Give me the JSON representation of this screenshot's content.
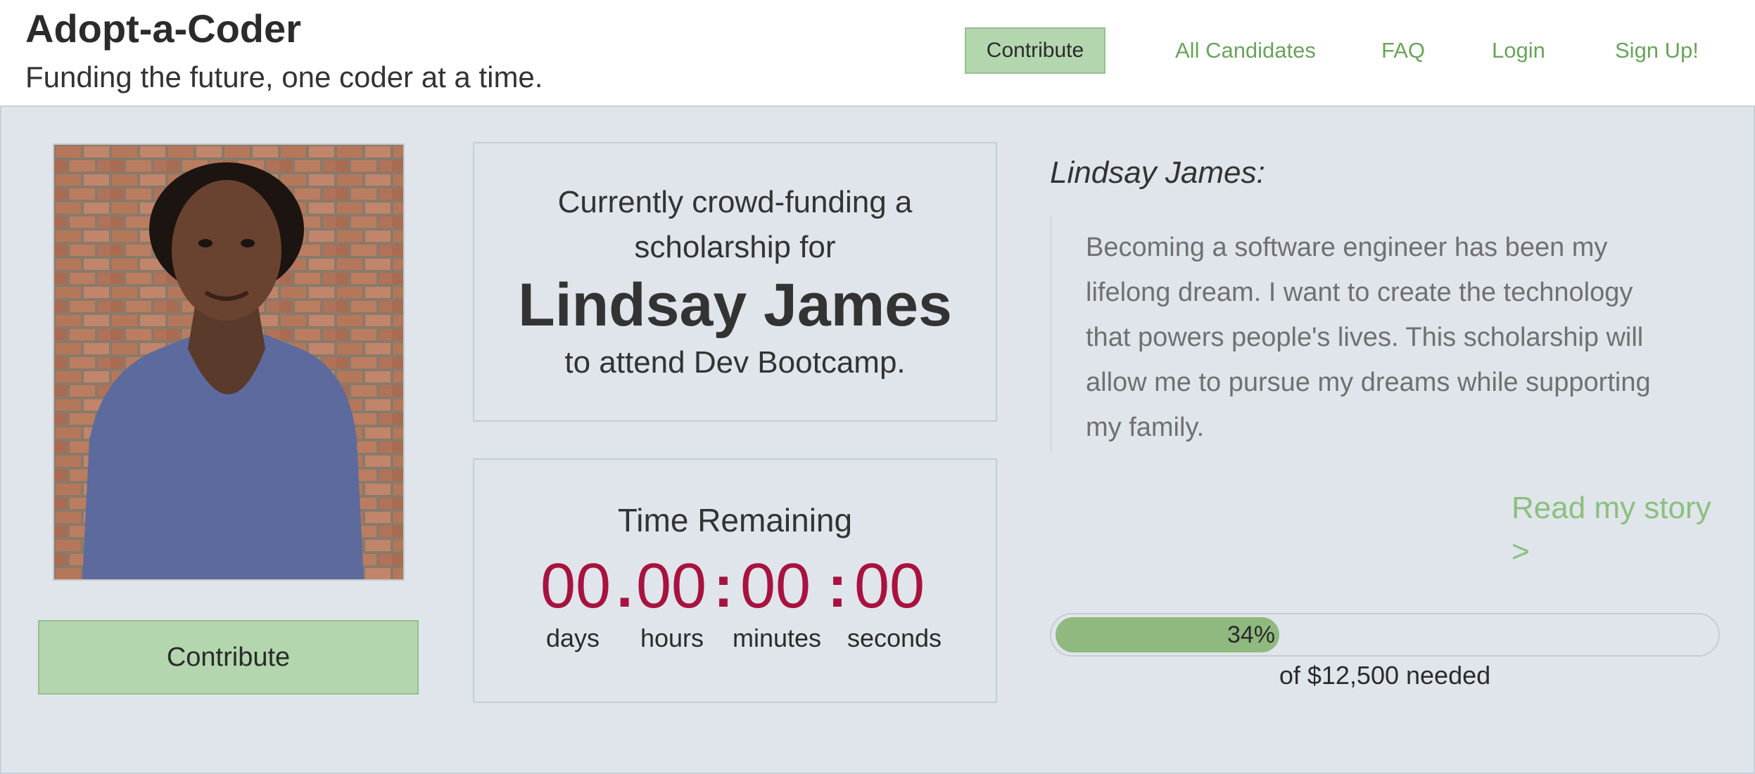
{
  "header": {
    "title": "Adopt-a-Coder",
    "tagline": "Funding the future, one coder at a time."
  },
  "nav": {
    "contribute": "Contribute",
    "all_candidates": "All Candidates",
    "faq": "FAQ",
    "login": "Login",
    "signup": "Sign Up!"
  },
  "candidate": {
    "photo_alt": "Portrait photo of Lindsay James",
    "contribute_button": "Contribute"
  },
  "intro": {
    "line1": "Currently crowd-funding a",
    "line2": "scholarship for",
    "name": "Lindsay James",
    "line3": "to attend Dev Bootcamp."
  },
  "timer": {
    "title": "Time Remaining",
    "days": "00",
    "hours": "00",
    "minutes": "00",
    "seconds": "00",
    "sep1": ".",
    "sep2": ":",
    "sep3": ":",
    "labels": {
      "days": "days",
      "hours": "hours",
      "minutes": "minutes",
      "seconds": "seconds"
    }
  },
  "story": {
    "name": "Lindsay James:",
    "quote": "Becoming a software engineer has been my lifelong dream. I want to create the technology that powers people's lives. This scholarship will allow me to pursue my dreams while supporting my family.",
    "read_more": "Read my story >"
  },
  "funding": {
    "percent": 34,
    "percent_label": "34%",
    "caption": "of $12,500 needed"
  },
  "colors": {
    "accent_green": "#b3d6ae",
    "link_green": "#6aa35c",
    "progress_green": "#8fb97e",
    "timer_red": "#a8123f",
    "panel_bg": "#dfe5eb"
  }
}
